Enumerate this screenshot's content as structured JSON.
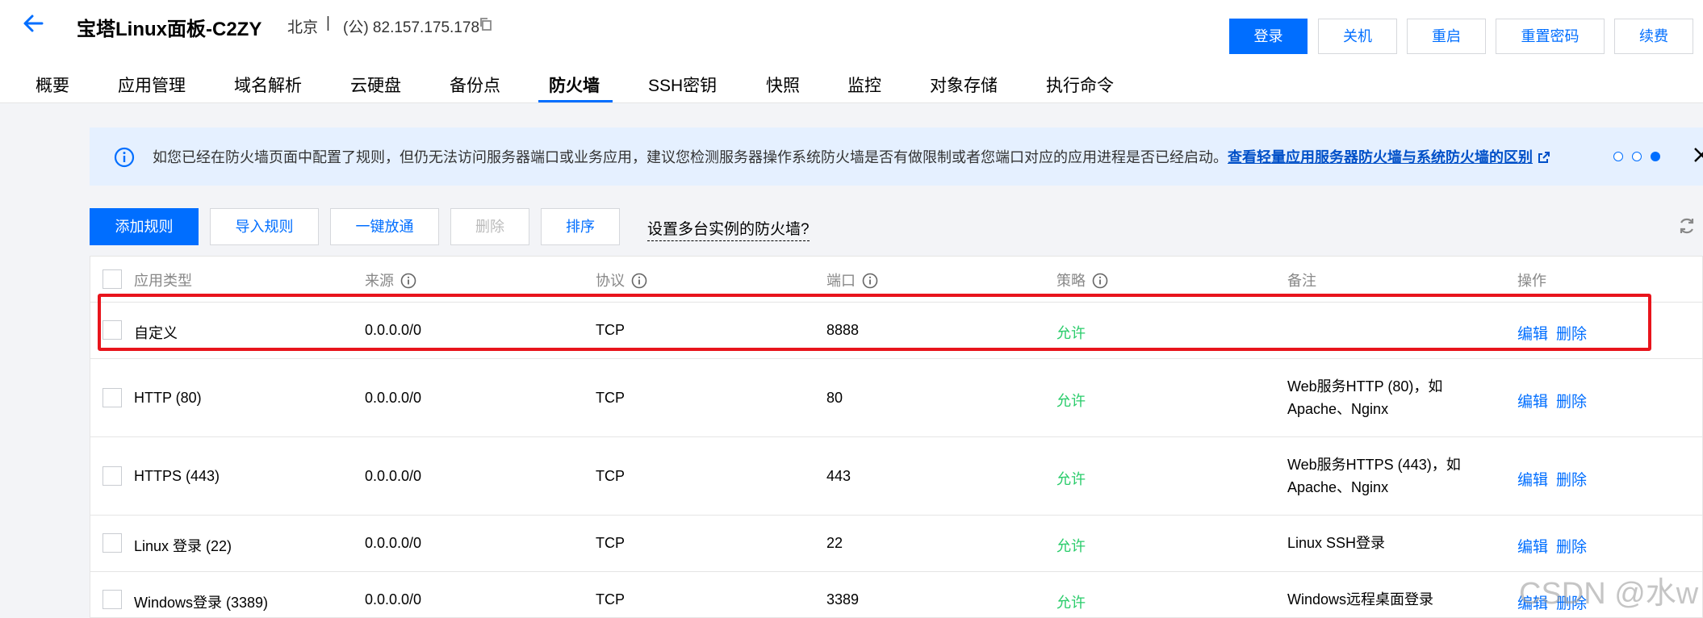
{
  "header": {
    "title": "宝塔Linux面板-C2ZY",
    "region": "北京",
    "separator": "|",
    "ip": "(公) 82.157.175.178",
    "buttons": [
      "登录",
      "关机",
      "重启",
      "重置密码",
      "续费"
    ]
  },
  "tabs": [
    "概要",
    "应用管理",
    "域名解析",
    "云硬盘",
    "备份点",
    "防火墙",
    "SSH密钥",
    "快照",
    "监控",
    "对象存储",
    "执行命令"
  ],
  "active_tab": "防火墙",
  "notice": {
    "text": "如您已经在防火墙页面中配置了规则，但仍无法访问服务器端口或业务应用，建议您检测服务器操作系统防火墙是否有做限制或者您端口对应的应用进程是否已经启动。",
    "link": "查看轻量应用服务器防火墙与系统防火墙的区别"
  },
  "toolbar": {
    "add": "添加规则",
    "import": "导入规则",
    "allow_all": "一键放通",
    "delete": "删除",
    "sort": "排序",
    "multi": "设置多台实例的防火墙?"
  },
  "table": {
    "columns": [
      "应用类型",
      "来源",
      "协议",
      "端口",
      "策略",
      "备注",
      "操作"
    ],
    "actions": {
      "edit": "编辑",
      "delete": "删除"
    },
    "rows": [
      {
        "type": "自定义",
        "source": "0.0.0.0/0",
        "protocol": "TCP",
        "port": "8888",
        "policy": "允许",
        "note": ""
      },
      {
        "type": "HTTP (80)",
        "source": "0.0.0.0/0",
        "protocol": "TCP",
        "port": "80",
        "policy": "允许",
        "note": "Web服务HTTP (80)，如Apache、Nginx"
      },
      {
        "type": "HTTPS (443)",
        "source": "0.0.0.0/0",
        "protocol": "TCP",
        "port": "443",
        "policy": "允许",
        "note": "Web服务HTTPS (443)，如Apache、Nginx"
      },
      {
        "type": "Linux 登录 (22)",
        "source": "0.0.0.0/0",
        "protocol": "TCP",
        "port": "22",
        "policy": "允许",
        "note": "Linux SSH登录"
      },
      {
        "type": "Windows登录 (3389)",
        "source": "0.0.0.0/0",
        "protocol": "TCP",
        "port": "3389",
        "policy": "允许",
        "note": "Windows远程桌面登录"
      }
    ]
  },
  "watermark": "CSDN @水w",
  "colors": {
    "accent": "#006eff",
    "allow": "#29cc6a",
    "highlight": "#e8141c",
    "notice_bg": "#e5f0ff"
  }
}
